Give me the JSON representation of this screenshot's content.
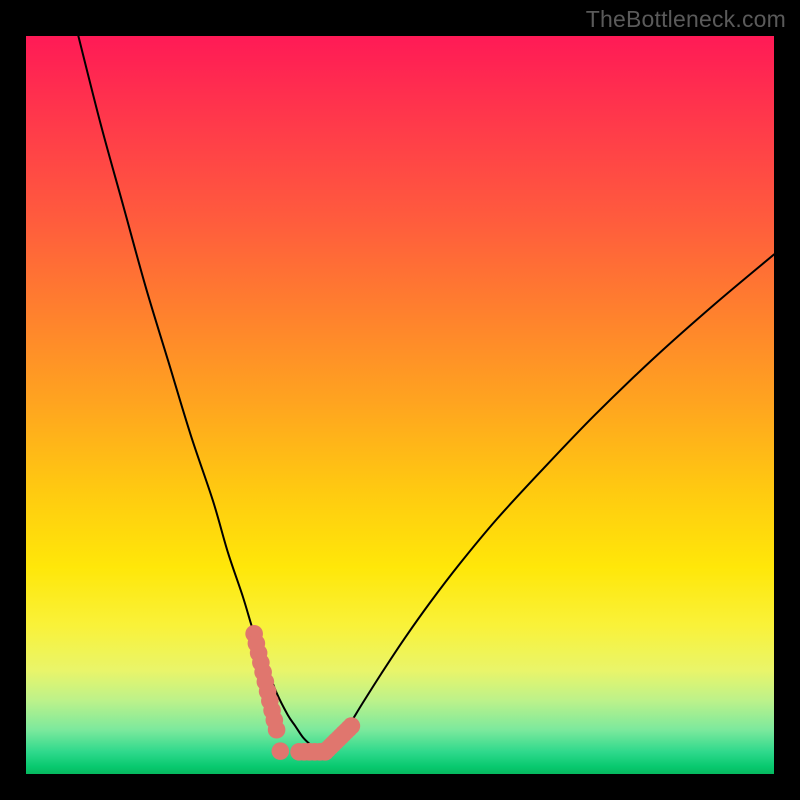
{
  "watermark": "TheBottleneck.com",
  "chart_data": {
    "type": "line",
    "title": "",
    "xlabel": "",
    "ylabel": "",
    "xlim": [
      0,
      100
    ],
    "ylim": [
      0,
      100
    ],
    "series": [
      {
        "name": "left-branch",
        "x": [
          7,
          10,
          13,
          16,
          19,
          22,
          25,
          27,
          29,
          30.5,
          32,
          33.5,
          35,
          36,
          37,
          38,
          39,
          40
        ],
        "y": [
          100,
          88,
          77,
          66,
          56,
          46,
          37,
          30,
          24,
          19,
          15,
          11,
          8,
          6.5,
          5,
          4,
          3.2,
          2.6
        ]
      },
      {
        "name": "right-branch",
        "x": [
          40,
          41.5,
          43,
          45,
          47.5,
          50.5,
          54,
          58,
          63,
          69,
          76,
          84,
          92,
          100
        ],
        "y": [
          2.6,
          4.2,
          6.3,
          9.6,
          13.6,
          18.2,
          23.2,
          28.5,
          34.6,
          41.2,
          48.6,
          56.4,
          63.6,
          70.4
        ]
      },
      {
        "name": "curve-marker",
        "x": [
          30.5,
          30.8,
          31.1,
          31.4,
          31.7,
          32.0,
          32.3,
          32.6,
          32.9,
          33.2,
          33.5,
          34.0,
          36.5,
          37.2,
          37.9,
          38.6,
          39.3,
          40.0,
          40.35,
          40.7,
          41.05,
          41.4,
          41.75,
          42.1,
          42.45,
          42.8,
          43.15,
          43.5
        ],
        "y": [
          19.0,
          17.7,
          16.4,
          15.1,
          13.8,
          12.5,
          11.2,
          9.9,
          8.6,
          7.3,
          6.0,
          3.1,
          3.0,
          3.0,
          3.0,
          3.0,
          3.0,
          3.0,
          3.35,
          3.7,
          4.05,
          4.4,
          4.75,
          5.1,
          5.45,
          5.8,
          6.15,
          6.5
        ]
      }
    ],
    "marker_color": "#e0766e",
    "curve_color": "#000000"
  }
}
